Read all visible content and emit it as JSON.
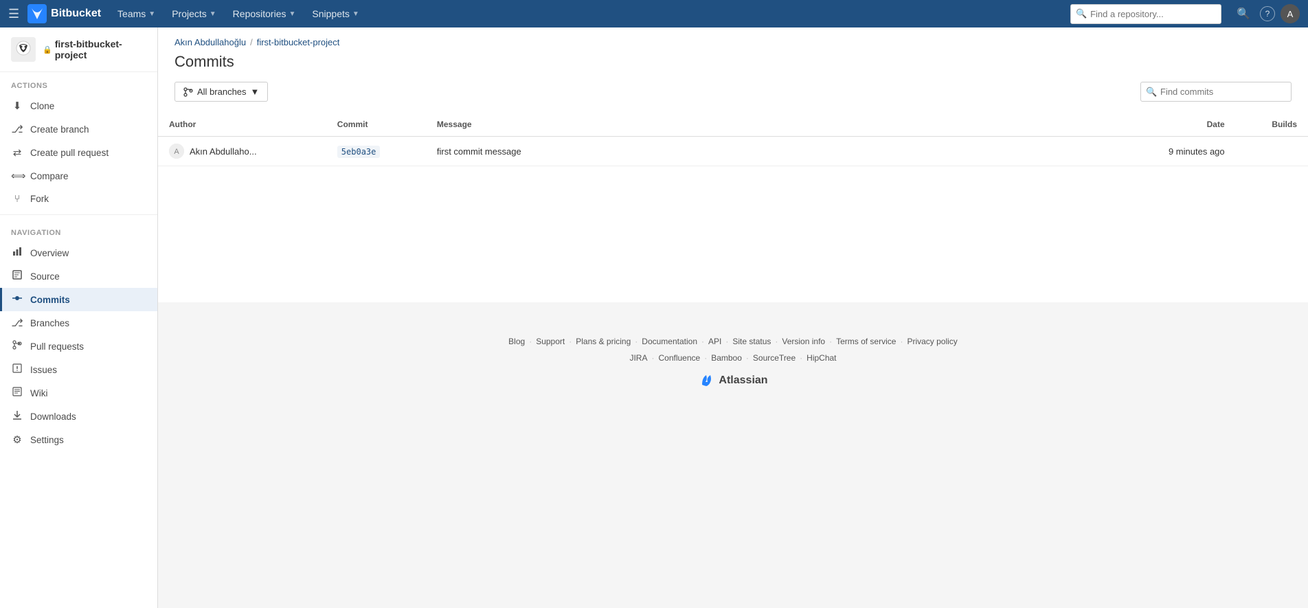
{
  "topnav": {
    "logo_text": "Bitbucket",
    "hamburger_icon": "☰",
    "nav_items": [
      {
        "label": "Teams",
        "has_dropdown": true
      },
      {
        "label": "Projects",
        "has_dropdown": true
      },
      {
        "label": "Repositories",
        "has_dropdown": true
      },
      {
        "label": "Snippets",
        "has_dropdown": true
      }
    ],
    "search_placeholder": "Find a repository...",
    "search_icon": "🔍",
    "help_icon": "?",
    "avatar_text": "A"
  },
  "sidebar": {
    "repo_name": "first-bitbucket-project",
    "repo_lock": "🔒",
    "actions_label": "ACTIONS",
    "actions": [
      {
        "id": "clone",
        "label": "Clone",
        "icon": "⬇"
      },
      {
        "id": "create-branch",
        "label": "Create branch",
        "icon": "⎇"
      },
      {
        "id": "create-pull-request",
        "label": "Create pull request",
        "icon": "⇄"
      },
      {
        "id": "compare",
        "label": "Compare",
        "icon": "⟺"
      },
      {
        "id": "fork",
        "label": "Fork",
        "icon": "⑂"
      }
    ],
    "navigation_label": "NAVIGATION",
    "nav_items": [
      {
        "id": "overview",
        "label": "Overview",
        "icon": "📊"
      },
      {
        "id": "source",
        "label": "Source",
        "icon": "📄"
      },
      {
        "id": "commits",
        "label": "Commits",
        "icon": "⬤",
        "active": true
      },
      {
        "id": "branches",
        "label": "Branches",
        "icon": "⎇"
      },
      {
        "id": "pull-requests",
        "label": "Pull requests",
        "icon": "⇄"
      },
      {
        "id": "issues",
        "label": "Issues",
        "icon": "!"
      },
      {
        "id": "wiki",
        "label": "Wiki",
        "icon": "📖"
      },
      {
        "id": "downloads",
        "label": "Downloads",
        "icon": "⬇"
      },
      {
        "id": "settings",
        "label": "Settings",
        "icon": "⚙"
      }
    ]
  },
  "breadcrumb": {
    "author": "Akın Abdullahoğlu",
    "repo": "first-bitbucket-project",
    "separator": "/"
  },
  "page": {
    "title": "Commits"
  },
  "commits": {
    "all_branches_label": "All branches",
    "find_placeholder": "Find commits",
    "table": {
      "headers": [
        "Author",
        "Commit",
        "Message",
        "Date",
        "Builds"
      ],
      "rows": [
        {
          "author_name": "Akın Abdullaho...",
          "commit_hash": "5eb0a3e",
          "message": "first commit message",
          "date": "9 minutes ago",
          "builds": ""
        }
      ]
    }
  },
  "footer": {
    "links": [
      {
        "label": "Blog"
      },
      {
        "label": "Support"
      },
      {
        "label": "Plans & pricing"
      },
      {
        "label": "Documentation"
      },
      {
        "label": "API"
      },
      {
        "label": "Site status"
      },
      {
        "label": "Version info"
      },
      {
        "label": "Terms of service"
      },
      {
        "label": "Privacy policy"
      }
    ],
    "tools": [
      {
        "label": "JIRA"
      },
      {
        "label": "Confluence"
      },
      {
        "label": "Bamboo"
      },
      {
        "label": "SourceTree"
      },
      {
        "label": "HipChat"
      }
    ],
    "atlassian_label": "Atlassian"
  }
}
